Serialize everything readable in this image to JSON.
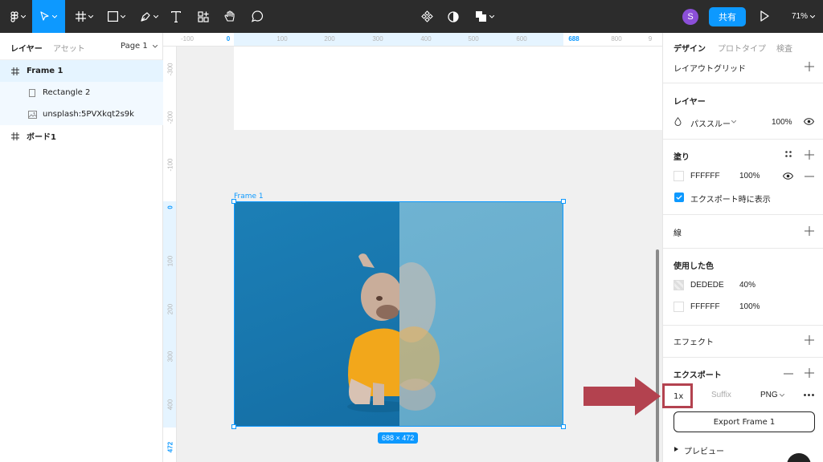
{
  "toolbar": {
    "share_label": "共有",
    "zoom": "71%",
    "user_initial": "S"
  },
  "left_panel": {
    "tabs": [
      "レイヤー",
      "アセット"
    ],
    "page_selector": "Page 1",
    "layers": [
      {
        "name": "Frame 1",
        "type": "frame"
      },
      {
        "name": "Rectangle 2",
        "type": "rectangle"
      },
      {
        "name": "unsplash:5PVXkqt2s9k",
        "type": "image"
      },
      {
        "name": "ボード1",
        "type": "frame"
      }
    ]
  },
  "canvas": {
    "ruler_top_ticks": [
      "-100",
      "0",
      "100",
      "200",
      "300",
      "400",
      "500",
      "600",
      "688",
      "800",
      "9"
    ],
    "ruler_left_ticks": [
      "-300",
      "-200",
      "-100",
      "0",
      "100",
      "200",
      "300",
      "400",
      "472"
    ],
    "frame_label": "Frame 1",
    "size_badge": "688 × 472"
  },
  "right_panel": {
    "tabs": [
      "デザイン",
      "プロトタイプ",
      "検査"
    ],
    "layout_grid": "レイアウトグリッド",
    "layer": {
      "title": "レイヤー",
      "blend_mode": "パススルー",
      "opacity": "100%"
    },
    "fill": {
      "title": "塗り",
      "hex": "FFFFFF",
      "opacity": "100%",
      "show_in_export": "エクスポート時に表示"
    },
    "stroke": {
      "title": "線"
    },
    "used_colors": {
      "title": "使用した色",
      "items": [
        {
          "hex": "DEDEDE",
          "opacity": "40%"
        },
        {
          "hex": "FFFFFF",
          "opacity": "100%"
        }
      ]
    },
    "effects": {
      "title": "エフェクト"
    },
    "export": {
      "title": "エクスポート",
      "scale": "1x",
      "suffix_placeholder": "Suffix",
      "format": "PNG",
      "button_label": "Export Frame 1",
      "preview": "プレビュー"
    }
  },
  "colors": {
    "accent": "#0d99ff",
    "annotation": "#b3424f",
    "toolbar_bg": "#2c2c2c"
  }
}
